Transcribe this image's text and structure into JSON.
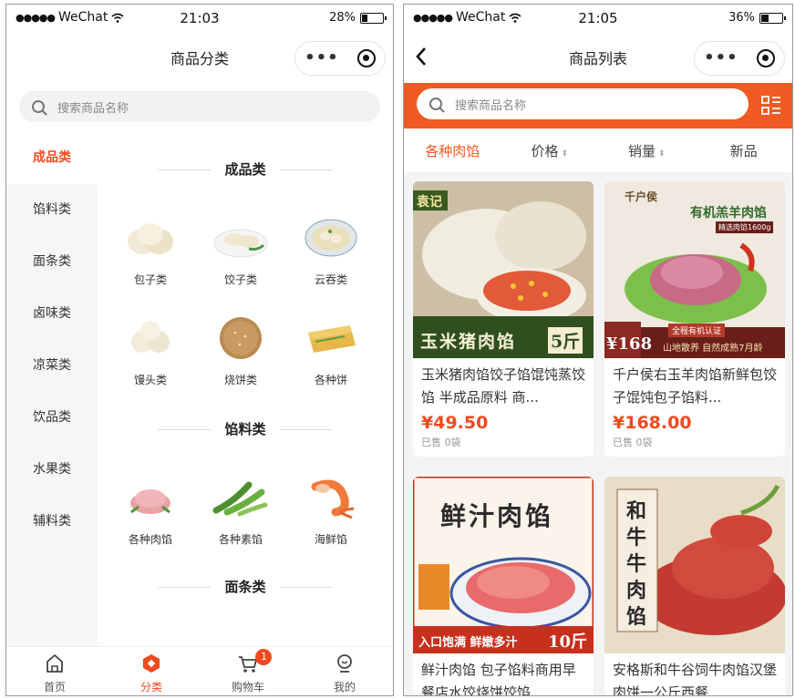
{
  "left_screen": {
    "status": {
      "carrier": "WeChat",
      "time": "21:03",
      "battery": "28%",
      "battery_level": 0.28
    },
    "nav": {
      "title": "商品分类"
    },
    "search": {
      "placeholder": "搜索商品名称"
    },
    "sidebar": {
      "items": [
        {
          "label": "成品类",
          "active": true
        },
        {
          "label": "馅料类"
        },
        {
          "label": "面条类"
        },
        {
          "label": "卤味类"
        },
        {
          "label": "凉菜类"
        },
        {
          "label": "饮品类"
        },
        {
          "label": "水果类"
        },
        {
          "label": "辅料类"
        }
      ]
    },
    "sections": [
      {
        "title": "成品类",
        "items": [
          "包子类",
          "饺子类",
          "云吞类",
          "馒头类",
          "烧饼类",
          "各种饼"
        ]
      },
      {
        "title": "馅料类",
        "items": [
          "各种肉馅",
          "各种素馅",
          "海鲜馅"
        ]
      },
      {
        "title": "面条类",
        "items": []
      }
    ],
    "tabbar": {
      "tabs": [
        {
          "label": "首页",
          "icon": "home-icon"
        },
        {
          "label": "分类",
          "icon": "category-icon",
          "active": true
        },
        {
          "label": "购物车",
          "icon": "cart-icon",
          "badge": "1"
        },
        {
          "label": "我的",
          "icon": "profile-icon"
        }
      ]
    }
  },
  "right_screen": {
    "status": {
      "carrier": "WeChat",
      "time": "21:05",
      "battery": "36%",
      "battery_level": 0.36
    },
    "nav": {
      "title": "商品列表"
    },
    "search": {
      "placeholder": "搜索商品名称"
    },
    "sort": {
      "items": [
        {
          "label": "各种肉馅",
          "active": true
        },
        {
          "label": "价格",
          "sortable": true
        },
        {
          "label": "销量",
          "sortable": true
        },
        {
          "label": "新品"
        }
      ]
    },
    "products": [
      {
        "name": "玉米猪肉馅饺子馅馄饨蒸饺馅 半成品原料 商...",
        "price": "¥49.50",
        "sold": "已售 0袋",
        "image_text": {
          "brand": "袁记",
          "title": "玉米猪肉馅",
          "qty": "5斤"
        }
      },
      {
        "name": "千户侯右玉羊肉馅新鲜包饺子馄饨包子馅料...",
        "price": "¥168.00",
        "sold": "已售 0袋",
        "image_text": {
          "brand": "千户侯",
          "title": "有机羔羊肉馅",
          "net": "精选肉馅1600g",
          "badge": "全程有机认证",
          "price": "¥168",
          "tags": "山地散养 自然成熟7月龄"
        }
      },
      {
        "name": "鲜汁肉馅 包子馅料商用早餐店水饺烧饼饺馅",
        "image_text": {
          "title": "鲜汁肉馅",
          "banner": "入口饱满 鲜嫩多汁",
          "qty": "10斤"
        }
      },
      {
        "name": "安格斯和牛谷饲牛肉馅汉堡肉饼一公斤西餐",
        "image_text": {
          "title": "和牛牛肉馅"
        }
      }
    ]
  },
  "colors": {
    "accent": "#f04a1e",
    "orange_bar": "#f15a22",
    "sidebar_bg": "#f6f6f6"
  }
}
